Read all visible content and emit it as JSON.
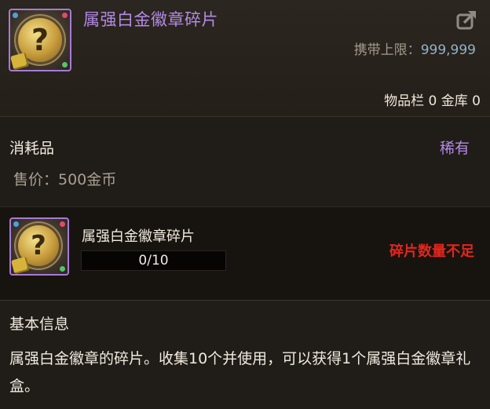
{
  "item": {
    "name": "属强白金徽章碎片",
    "carry_limit_label": "携带上限：",
    "carry_limit_value": "999,999",
    "storage_text": "物品栏 0 金库 0",
    "type": "消耗品",
    "rarity": "稀有",
    "price": "售价：500金币",
    "icon_glyph": "?"
  },
  "fragment": {
    "name": "属强白金徽章碎片",
    "progress_text": "0/10",
    "progress_fraction": 0.0,
    "status": "碎片数量不足"
  },
  "info": {
    "title": "基本信息",
    "description": "属强白金徽章的碎片。收集10个并使用，可以获得1个属强白金徽章礼盒。"
  },
  "colors": {
    "rarity_purple": "#b48ae6",
    "warning_red": "#e2261e",
    "limit_blue": "#8fb3c8"
  },
  "icons": {
    "share": "share-icon",
    "item": "badge-fragment-icon"
  }
}
